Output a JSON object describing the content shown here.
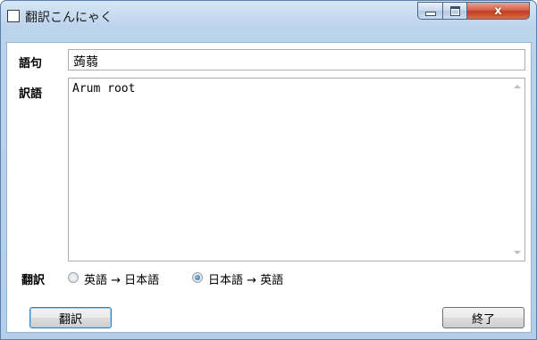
{
  "window": {
    "title": "翻訳こんにゃく",
    "buttons": {
      "minimize_icon": "minimize-icon",
      "maximize_icon": "maximize-icon",
      "close_glyph": "x"
    }
  },
  "form": {
    "goku_label": "語句",
    "goku_value": "蒟蒻",
    "yakugo_label": "訳語",
    "yakugo_value": "Arum root",
    "direction_label": "翻訳",
    "options": [
      {
        "label": "英語 → 日本語",
        "selected": false
      },
      {
        "label": "日本語 → 英語",
        "selected": true
      }
    ],
    "translate_button": "翻訳",
    "exit_button": "終了"
  }
}
